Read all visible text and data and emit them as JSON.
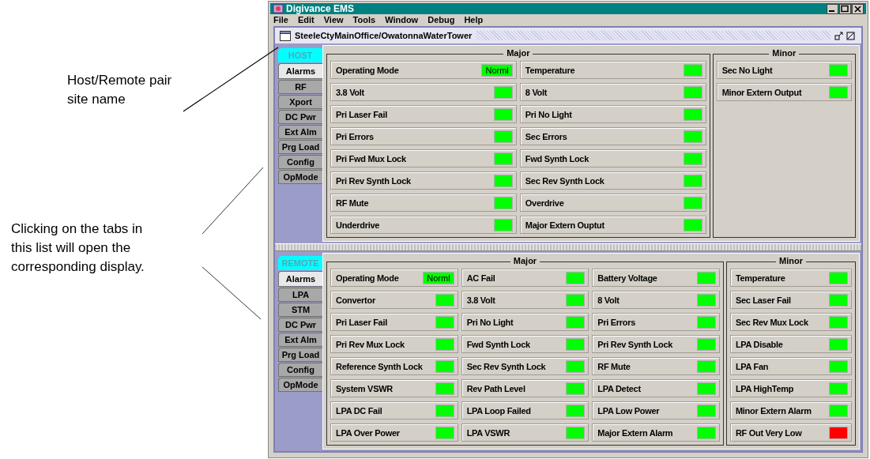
{
  "annotations": [
    "Host/Remote pair site name",
    "Clicking on the tabs in this list will open the corresponding display."
  ],
  "window": {
    "title": "Digivance EMS"
  },
  "menu": [
    "File",
    "Edit",
    "View",
    "Tools",
    "Window",
    "Debug",
    "Help"
  ],
  "frame": {
    "title": "SteeleCtyMainOffice/OwatonnaWaterTower"
  },
  "panels": [
    {
      "header": "HOST",
      "tabs": [
        {
          "label": "Alarms",
          "selected": true
        },
        {
          "label": "RF",
          "selected": false
        },
        {
          "label": "Xport",
          "selected": false
        },
        {
          "label": "DC Pwr",
          "selected": false
        },
        {
          "label": "Ext Alm",
          "selected": false
        },
        {
          "label": "Prg Load",
          "selected": false
        },
        {
          "label": "Config",
          "selected": false
        },
        {
          "label": "OpMode",
          "selected": false
        }
      ],
      "major": {
        "title": "Major",
        "alarms": [
          {
            "label": "Operating Mode",
            "color": "#00ff00",
            "value": "Norml"
          },
          {
            "label": "Temperature",
            "color": "#00ff00"
          },
          {
            "label": "3.8 Volt",
            "color": "#00ff00"
          },
          {
            "label": "8 Volt",
            "color": "#00ff00"
          },
          {
            "label": "Pri Laser Fail",
            "color": "#00ff00"
          },
          {
            "label": "Pri No Light",
            "color": "#00ff00"
          },
          {
            "label": "Pri Errors",
            "color": "#00ff00"
          },
          {
            "label": "Sec Errors",
            "color": "#00ff00"
          },
          {
            "label": "Pri Fwd Mux Lock",
            "color": "#00ff00"
          },
          {
            "label": "Fwd Synth Lock",
            "color": "#00ff00"
          },
          {
            "label": "Pri Rev Synth Lock",
            "color": "#00ff00"
          },
          {
            "label": "Sec Rev Synth Lock",
            "color": "#00ff00"
          },
          {
            "label": "RF Mute",
            "color": "#00ff00"
          },
          {
            "label": "Overdrive",
            "color": "#00ff00"
          },
          {
            "label": "Underdrive",
            "color": "#00ff00"
          },
          {
            "label": "Major Extern Ouptut",
            "color": "#00ff00"
          }
        ]
      },
      "minor": {
        "title": "Minor",
        "alarms": [
          {
            "label": "Sec No Light",
            "color": "#00ff00"
          },
          {
            "label": "Minor Extern Output",
            "color": "#00ff00"
          }
        ]
      }
    },
    {
      "header": "REMOTE",
      "tabs": [
        {
          "label": "Alarms",
          "selected": true
        },
        {
          "label": "LPA",
          "selected": false
        },
        {
          "label": "STM",
          "selected": false
        },
        {
          "label": "DC Pwr",
          "selected": false
        },
        {
          "label": "Ext Alm",
          "selected": false
        },
        {
          "label": "Prg Load",
          "selected": false
        },
        {
          "label": "Config",
          "selected": false
        },
        {
          "label": "OpMode",
          "selected": false
        }
      ],
      "major": {
        "title": "Major",
        "alarms": [
          {
            "label": "Operating Mode",
            "color": "#00ff00",
            "value": "Norml"
          },
          {
            "label": "AC Fail",
            "color": "#00ff00"
          },
          {
            "label": "Battery Voltage",
            "color": "#00ff00"
          },
          {
            "label": "Convertor",
            "color": "#00ff00"
          },
          {
            "label": "3.8 Volt",
            "color": "#00ff00"
          },
          {
            "label": "8 Volt",
            "color": "#00ff00"
          },
          {
            "label": "Pri Laser Fail",
            "color": "#00ff00"
          },
          {
            "label": "Pri No Light",
            "color": "#00ff00"
          },
          {
            "label": "Pri Errors",
            "color": "#00ff00"
          },
          {
            "label": "Pri Rev Mux Lock",
            "color": "#00ff00"
          },
          {
            "label": "Fwd Synth Lock",
            "color": "#00ff00"
          },
          {
            "label": "Pri Rev Synth Lock",
            "color": "#00ff00"
          },
          {
            "label": "Reference Synth Lock",
            "color": "#00ff00"
          },
          {
            "label": "Sec Rev Synth Lock",
            "color": "#00ff00"
          },
          {
            "label": "RF Mute",
            "color": "#00ff00"
          },
          {
            "label": "System VSWR",
            "color": "#00ff00"
          },
          {
            "label": "Rev Path Level",
            "color": "#00ff00"
          },
          {
            "label": "LPA Detect",
            "color": "#00ff00"
          },
          {
            "label": "LPA DC Fail",
            "color": "#00ff00"
          },
          {
            "label": "LPA Loop Failed",
            "color": "#00ff00"
          },
          {
            "label": "LPA Low Power",
            "color": "#00ff00"
          },
          {
            "label": "LPA Over Power",
            "color": "#00ff00"
          },
          {
            "label": "LPA VSWR",
            "color": "#00ff00"
          },
          {
            "label": "Major Extern Alarm",
            "color": "#00ff00"
          }
        ]
      },
      "minor": {
        "title": "Minor",
        "alarms": [
          {
            "label": "Temperature",
            "color": "#00ff00"
          },
          {
            "label": "Sec Laser Fail",
            "color": "#00ff00"
          },
          {
            "label": "Sec Rev Mux Lock",
            "color": "#00ff00"
          },
          {
            "label": "LPA Disable",
            "color": "#00ff00"
          },
          {
            "label": "LPA Fan",
            "color": "#00ff00"
          },
          {
            "label": "LPA HighTemp",
            "color": "#00ff00"
          },
          {
            "label": "Minor Extern Alarm",
            "color": "#00ff00"
          },
          {
            "label": "RF Out Very Low",
            "color": "#ff0000"
          }
        ]
      }
    }
  ]
}
